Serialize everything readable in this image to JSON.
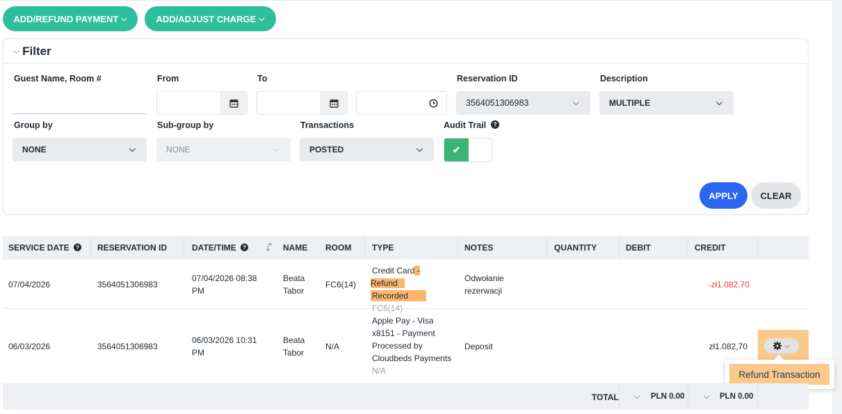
{
  "toolbar": {
    "add_refund_payment": "ADD/REFUND PAYMENT",
    "add_adjust_charge": "ADD/ADJUST CHARGE"
  },
  "filter": {
    "title": "Filter",
    "guest_label": "Guest Name, Room #",
    "guest_value": "",
    "from_label": "From",
    "from_value": "",
    "to_label": "To",
    "to_value": "",
    "time_value": "",
    "reservation_label": "Reservation ID",
    "reservation_value": "3564051306983",
    "description_label": "Description",
    "description_value": "MULTIPLE",
    "group_label": "Group by",
    "group_value": "NONE",
    "subgroup_label": "Sub-group by",
    "subgroup_value": "NONE",
    "transactions_label": "Transactions",
    "transactions_value": "POSTED",
    "audit_label": "Audit Trail",
    "audit_enabled": true,
    "apply_label": "APPLY",
    "clear_label": "CLEAR"
  },
  "table": {
    "headers": {
      "service_date": "SERVICE DATE",
      "reservation_id": "RESERVATION ID",
      "datetime": "DATE/TIME",
      "name": "NAME",
      "room": "ROOM",
      "type": "TYPE",
      "notes": "NOTES",
      "quantity": "QUANTITY",
      "debit": "DEBIT",
      "credit": "CREDIT"
    },
    "rows": [
      {
        "service_date": "07/04/2026",
        "reservation_id": "3564051306983",
        "datetime_1": "07/04/2026 08:38",
        "datetime_2": "PM",
        "name_1": "Beata",
        "name_2": "Tabor",
        "room": "FC6(14)",
        "type_a": "Credit Card",
        "type_b": " - ",
        "type_c": "Refund",
        "type_d": "Recorded",
        "type_sub": "FC6(14)",
        "notes_1": "Odwołanie",
        "notes_2": "rezerwacji",
        "quantity": "",
        "debit": "",
        "credit": "-zł1.082,70"
      },
      {
        "service_date": "06/03/2026",
        "reservation_id": "3564051306983",
        "datetime_1": "06/03/2026 10:31",
        "datetime_2": "PM",
        "name_1": "Beata",
        "name_2": "Tabor",
        "room": "N/A",
        "type_1": "Apple Pay - Visa",
        "type_2": "x8151 - Payment",
        "type_3": "Processed by",
        "type_4": "Cloudbeds Payments",
        "type_sub": "N/A",
        "notes": "Deposit",
        "quantity": "",
        "debit": "",
        "credit": "zł1.082,70"
      }
    ],
    "action_menu": {
      "refund_transaction": "Refund Transaction"
    },
    "total": {
      "label": "TOTAL",
      "debit": "PLN 0.00",
      "credit": "PLN 0.00"
    }
  },
  "icons": {
    "calendar": "calendar-icon",
    "clock": "clock-icon",
    "help": "help-circle-icon",
    "sort": "sort-icon",
    "gear": "gear-icon",
    "check": "check-icon"
  },
  "colors": {
    "primary_green": "#2dbe9c",
    "apply_blue": "#2a66ee",
    "toggle_green": "#3bb574",
    "negative_red": "#e53935",
    "highlight_orange": "#fbb86c"
  }
}
